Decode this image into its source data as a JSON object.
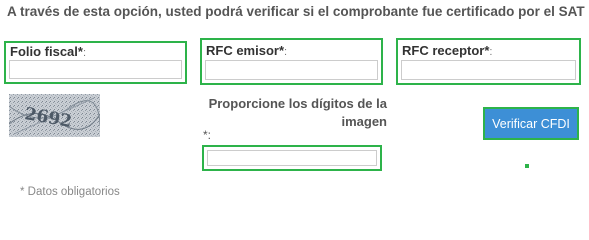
{
  "intro": "A través de esta opción, usted podrá verificar si el comprobante fue certificado por el SAT",
  "fields": [
    {
      "label": "Folio fiscal*",
      "colon": ":",
      "value": ""
    },
    {
      "label": "RFC emisor*",
      "colon": ":",
      "value": ""
    },
    {
      "label": "RFC receptor*",
      "colon": ":",
      "value": ""
    }
  ],
  "captcha": {
    "image_text": "2692",
    "prompt": "Proporcione los dígitos de la imagen",
    "required_marker": "*:",
    "value": ""
  },
  "verify_button": {
    "label": "Verificar CFDI"
  },
  "mandatory_note": "* Datos obligatorios",
  "colors": {
    "highlight": "#2db34a",
    "button": "#3d8fd6"
  }
}
